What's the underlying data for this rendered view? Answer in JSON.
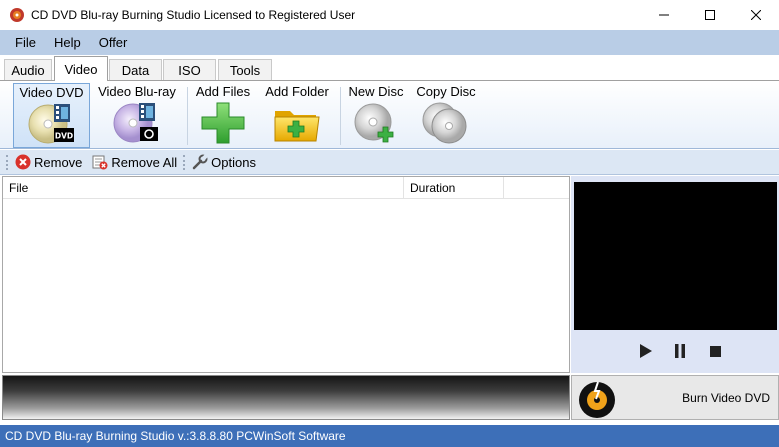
{
  "window": {
    "title": "CD DVD Blu-ray Burning Studio Licensed to Registered User"
  },
  "menu": [
    "File",
    "Help",
    "Offer"
  ],
  "tabs": [
    {
      "label": "Audio",
      "active": false
    },
    {
      "label": "Video",
      "active": true
    },
    {
      "label": "Data",
      "active": false
    },
    {
      "label": "ISO",
      "active": false
    },
    {
      "label": "Tools",
      "active": false
    }
  ],
  "ribbon": {
    "video_dvd": "Video DVD",
    "dvd_badge": "DVD",
    "video_bluray": "Video Blu-ray",
    "add_files": "Add Files",
    "add_folder": "Add Folder",
    "new_disc": "New Disc",
    "copy_disc": "Copy Disc"
  },
  "toolbar": {
    "remove": "Remove",
    "remove_all": "Remove All",
    "options": "Options"
  },
  "list": {
    "col_file": "File",
    "col_duration": "Duration"
  },
  "burn": {
    "label": "Burn Video DVD"
  },
  "status": {
    "text": "CD DVD Blu-ray Burning Studio v.:3.8.8.80 PCWinSoft Software"
  },
  "colors": {
    "menubar": "#b9cde6",
    "statusbar": "#3d6fb8",
    "accent_green": "#3cb043",
    "folder_yellow": "#f7c600"
  },
  "icons": {
    "app": "disc-burn-icon",
    "remove": "red-x-circle-icon",
    "remove_all": "remove-all-icon",
    "options": "wrench-icon",
    "play": "play-icon",
    "pause": "pause-icon",
    "stop": "stop-icon"
  }
}
